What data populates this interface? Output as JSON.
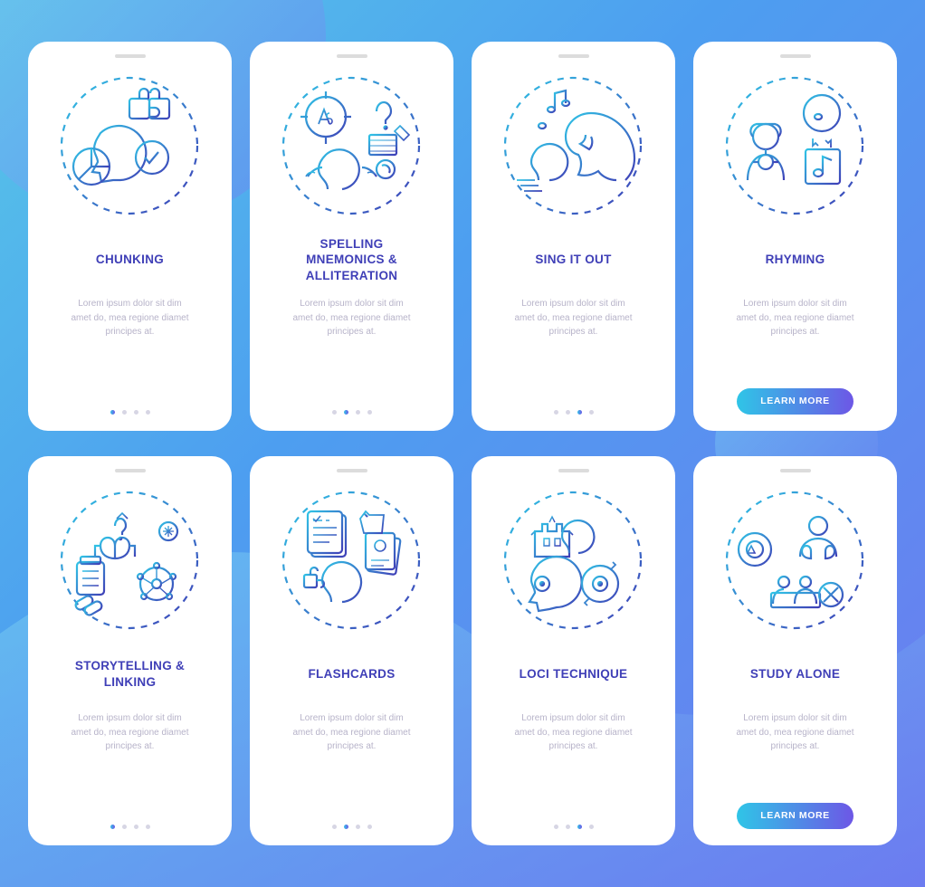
{
  "common": {
    "body_text": "Lorem ipsum dolor sit dim\namet do, mea regione diamet\nprincipes at.",
    "cta_label": "LEARN MORE"
  },
  "cards": [
    {
      "id": "chunking",
      "title": "CHUNKING",
      "active_dot": 0,
      "has_button": false
    },
    {
      "id": "spelling",
      "title": "SPELLING\nMNEMONICS &\nALLITERATION",
      "active_dot": 1,
      "has_button": false
    },
    {
      "id": "sing",
      "title": "SING IT OUT",
      "active_dot": 2,
      "has_button": false
    },
    {
      "id": "rhyming",
      "title": "RHYMING",
      "active_dot": 3,
      "has_button": true
    },
    {
      "id": "storytelling",
      "title": "STORYTELLING &\nLINKING",
      "active_dot": 0,
      "has_button": false
    },
    {
      "id": "flashcards",
      "title": "FLASHCARDS",
      "active_dot": 1,
      "has_button": false
    },
    {
      "id": "loci",
      "title": "LOCI TECHNIQUE",
      "active_dot": 2,
      "has_button": false
    },
    {
      "id": "studyalone",
      "title": "STUDY ALONE",
      "active_dot": 3,
      "has_button": true
    }
  ]
}
